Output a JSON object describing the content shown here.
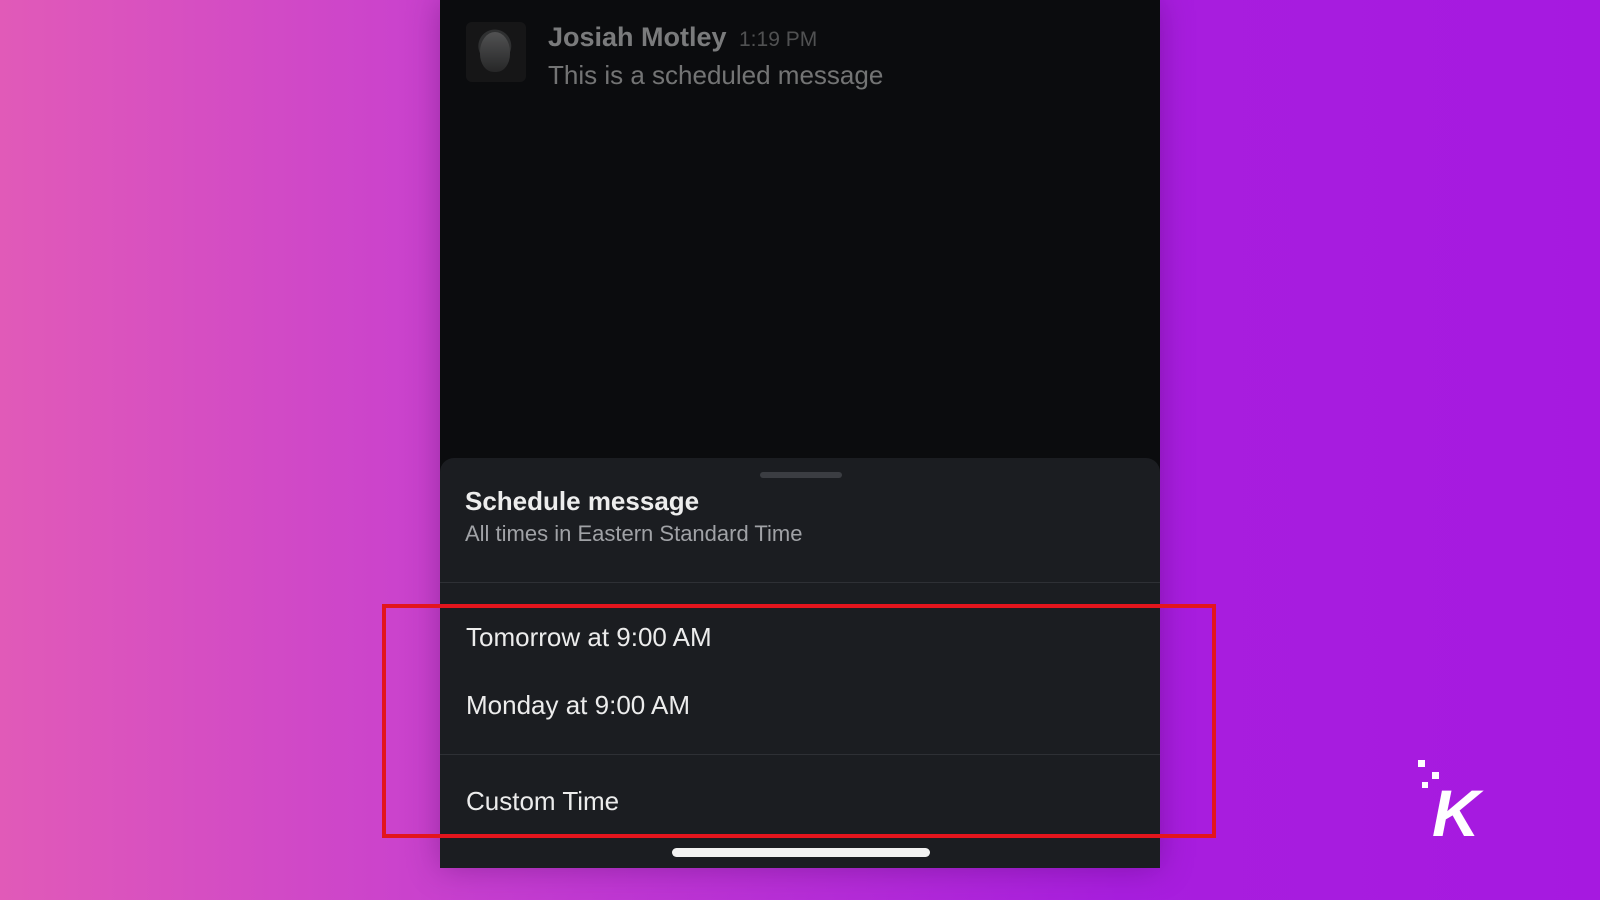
{
  "message": {
    "sender": "Josiah Motley",
    "time": "1:19 PM",
    "text": "This is a scheduled message"
  },
  "schedule_sheet": {
    "title": "Schedule message",
    "subtitle": "All times in Eastern Standard Time",
    "options": [
      {
        "label": "Tomorrow at 9:00 AM"
      },
      {
        "label": "Monday at 9:00 AM"
      },
      {
        "label": "Custom Time"
      }
    ]
  },
  "annotation": {
    "highlight_color": "#e3151d"
  },
  "brand": {
    "logo_letter": "K",
    "logo_color": "#ffffff"
  },
  "colors": {
    "background_left": "#e15ab8",
    "background_right": "#a619e0",
    "phone_background": "#0b0c0e",
    "sheet_background": "#1b1d21"
  }
}
